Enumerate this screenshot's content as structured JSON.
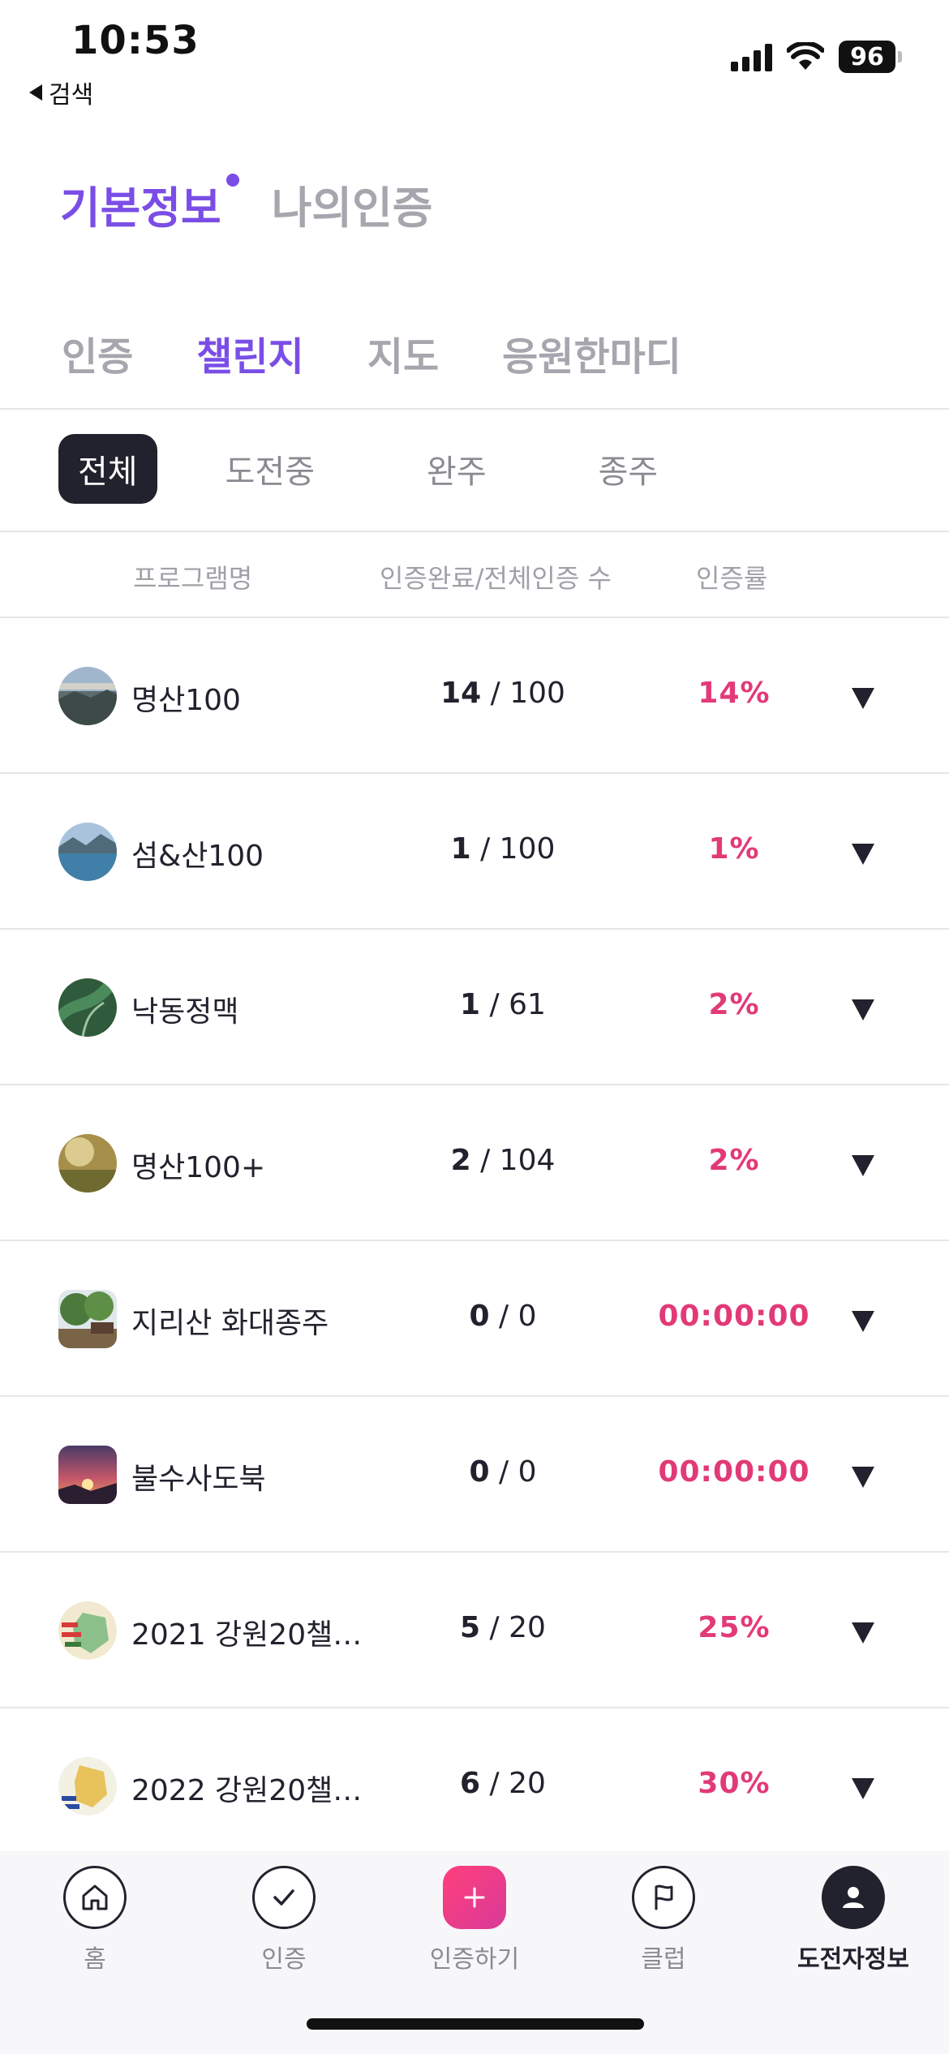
{
  "status": {
    "time": "10:53",
    "back_label": "검색",
    "battery": "96"
  },
  "top_tabs": [
    {
      "label": "기본정보",
      "active": true
    },
    {
      "label": "나의인증",
      "active": false
    }
  ],
  "sub_tabs": [
    {
      "label": "인증",
      "active": false
    },
    {
      "label": "챌린지",
      "active": true
    },
    {
      "label": "지도",
      "active": false
    },
    {
      "label": "응원한마디",
      "active": false
    }
  ],
  "filters": [
    {
      "label": "전체",
      "active": true
    },
    {
      "label": "도전중",
      "active": false
    },
    {
      "label": "완주",
      "active": false
    },
    {
      "label": "종주",
      "active": false
    }
  ],
  "table": {
    "headers": {
      "program": "프로그램명",
      "count": "인증완료/전체인증 수",
      "rate": "인증률"
    },
    "rows": [
      {
        "name": "명산100",
        "done": "14",
        "total": " / 100",
        "rate": "14%"
      },
      {
        "name": "섬&산100",
        "done": "1",
        "total": " / 100",
        "rate": "1%"
      },
      {
        "name": "낙동정맥",
        "done": "1",
        "total": " / 61",
        "rate": "2%"
      },
      {
        "name": "명산100+",
        "done": "2",
        "total": " / 104",
        "rate": "2%"
      },
      {
        "name": "지리산 화대종주",
        "done": "0",
        "total": " / 0",
        "rate": "00:00:00"
      },
      {
        "name": "불수사도북",
        "done": "0",
        "total": " / 0",
        "rate": "00:00:00"
      },
      {
        "name": "2021 강원20챌…",
        "done": "5",
        "total": " / 20",
        "rate": "25%"
      },
      {
        "name": "2022 강원20챌…",
        "done": "6",
        "total": " / 20",
        "rate": "30%"
      }
    ]
  },
  "bottom_nav": [
    {
      "label": "홈",
      "icon": "home-icon",
      "active": false
    },
    {
      "label": "인증",
      "icon": "check-icon",
      "active": false
    },
    {
      "label": "인증하기",
      "icon": "plus-icon",
      "active": false
    },
    {
      "label": "클럽",
      "icon": "flag-icon",
      "active": false
    },
    {
      "label": "도전자정보",
      "icon": "user-icon",
      "active": true
    }
  ],
  "colors": {
    "accent": "#7a4ee6",
    "rate": "#e23a77",
    "dark": "#22222e"
  }
}
